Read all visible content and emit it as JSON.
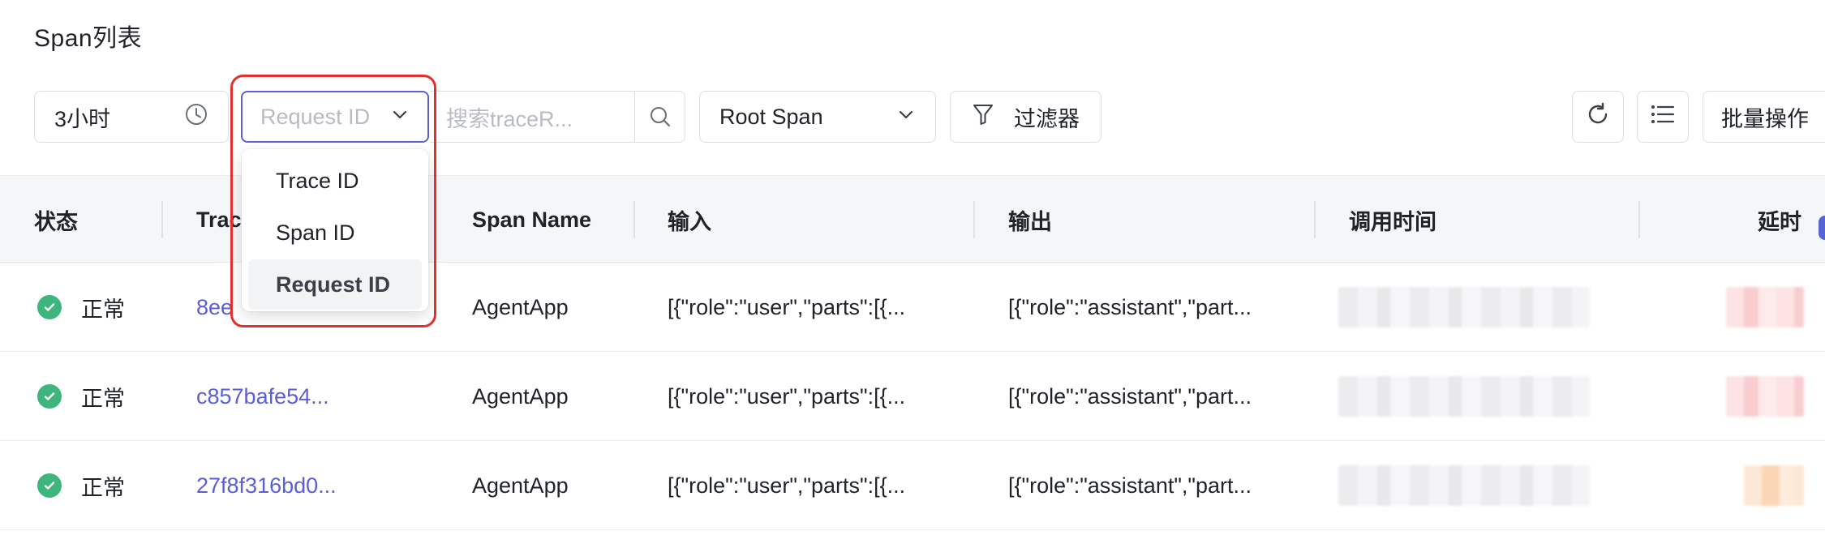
{
  "page": {
    "title": "Span列表"
  },
  "toolbar": {
    "time_range": "3小时",
    "id_type_placeholder": "Request ID",
    "search_placeholder": "搜索traceR...",
    "span_type": "Root Span",
    "filter_label": "过滤器",
    "batch_label": "批量操作"
  },
  "dropdown": {
    "options": [
      "Trace ID",
      "Span ID",
      "Request ID"
    ],
    "selected": "Request ID"
  },
  "table": {
    "columns": [
      "状态",
      "Trac",
      "Span Name",
      "输入",
      "输出",
      "调用时间",
      "延时"
    ],
    "rows": [
      {
        "status": "正常",
        "trace_id": "8ee",
        "span_name": "AgentApp",
        "input": "[{\"role\":\"user\",\"parts\":[{...",
        "output": "[{\"role\":\"assistant\",\"part..."
      },
      {
        "status": "正常",
        "trace_id": "c857bafe54...",
        "span_name": "AgentApp",
        "input": "[{\"role\":\"user\",\"parts\":[{...",
        "output": "[{\"role\":\"assistant\",\"part..."
      },
      {
        "status": "正常",
        "trace_id": "27f8f316bd0...",
        "span_name": "AgentApp",
        "input": "[{\"role\":\"user\",\"parts\":[{...",
        "output": "[{\"role\":\"assistant\",\"part..."
      }
    ]
  },
  "colors": {
    "accent": "#5b5fd6",
    "success": "#3fb57e",
    "highlight": "#e0312f"
  }
}
